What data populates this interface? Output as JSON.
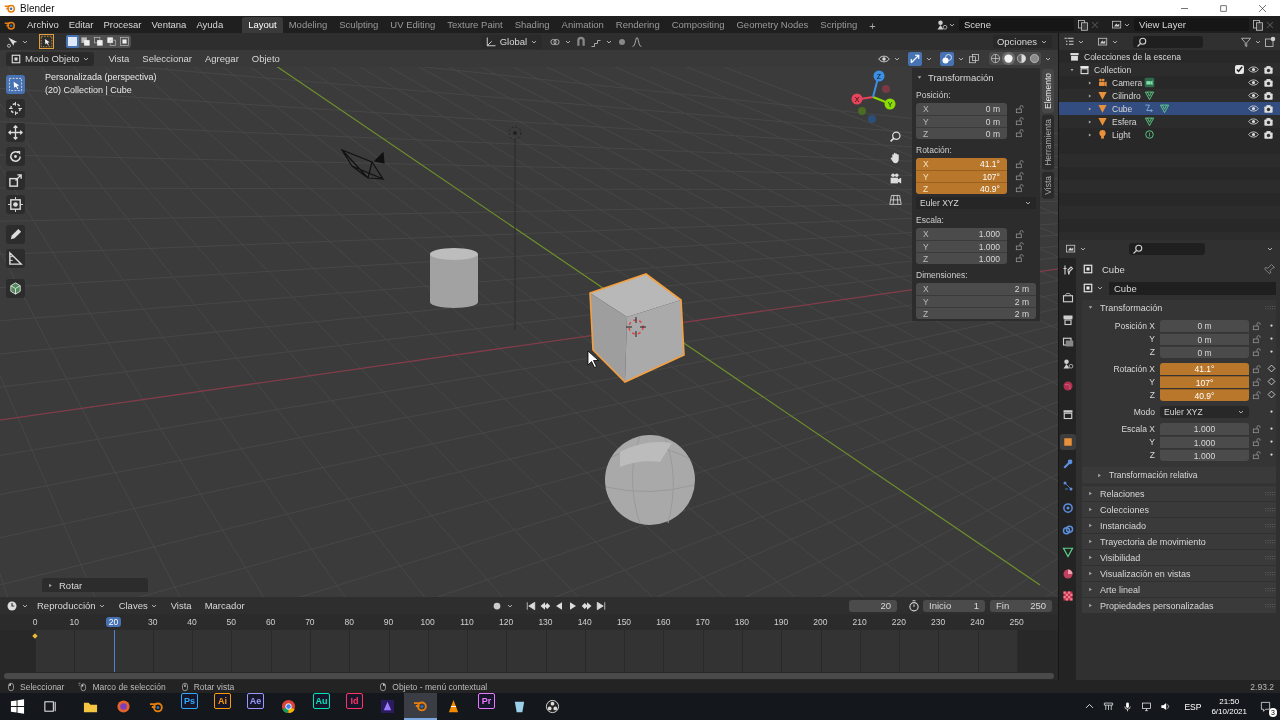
{
  "window": {
    "title": "Blender"
  },
  "top_bar": {
    "menus": [
      "Archivo",
      "Editar",
      "Procesar",
      "Ventana",
      "Ayuda"
    ],
    "workspaces": [
      {
        "label": "Layout",
        "selected": true
      },
      {
        "label": "Modeling",
        "selected": false
      },
      {
        "label": "Sculpting",
        "selected": false
      },
      {
        "label": "UV Editing",
        "selected": false
      },
      {
        "label": "Texture Paint",
        "selected": false
      },
      {
        "label": "Shading",
        "selected": false
      },
      {
        "label": "Animation",
        "selected": false
      },
      {
        "label": "Rendering",
        "selected": false
      },
      {
        "label": "Compositing",
        "selected": false
      },
      {
        "label": "Geometry Nodes",
        "selected": false
      },
      {
        "label": "Scripting",
        "selected": false
      }
    ],
    "add_workspace": "+",
    "scene": "Scene",
    "view_layer": "View Layer"
  },
  "tool_header": {
    "select_modes": [
      {
        "selected": true
      },
      {
        "selected": false
      },
      {
        "selected": false
      },
      {
        "selected": false
      },
      {
        "selected": false
      }
    ],
    "orientation": "Global",
    "options": "Opciones"
  },
  "viewport_header": {
    "mode": "Modo Objeto",
    "menus": [
      "Vista",
      "Seleccionar",
      "Agregar",
      "Objeto"
    ],
    "shading": [
      {
        "kind": "wireframe",
        "selected": false
      },
      {
        "kind": "solid",
        "selected": true
      },
      {
        "kind": "material",
        "selected": false
      },
      {
        "kind": "rendered",
        "selected": false
      }
    ]
  },
  "viewport": {
    "view_name": "Personalizada (perspectiva)",
    "context": "(20) Collection | Cube",
    "tools": [
      {
        "kind": "select",
        "selected": true
      },
      {
        "kind": "cursor",
        "selected": false
      },
      {
        "kind": "move",
        "selected": false
      },
      {
        "kind": "rotate",
        "selected": false
      },
      {
        "kind": "scale",
        "selected": false
      },
      {
        "kind": "transform",
        "selected": false
      },
      {
        "kind": "annotate",
        "selected": false
      },
      {
        "kind": "measure",
        "selected": false
      },
      {
        "kind": "add_cube",
        "selected": false
      }
    ],
    "gizmo": [
      {
        "label": "X",
        "color": "#e5445a"
      },
      {
        "label": "Y",
        "color": "#8bdc00"
      },
      {
        "label": "Z",
        "color": "#3a8fe6"
      }
    ],
    "last_operator": "Rotar"
  },
  "sidebar": {
    "tabs": [
      {
        "label": "Elemento",
        "selected": true
      },
      {
        "label": "Herramienta",
        "selected": false
      },
      {
        "label": "Vista",
        "selected": false
      }
    ],
    "title": "Transformación",
    "groups": [
      {
        "label": "Posición:",
        "locks": true,
        "fields": [
          {
            "axis": "X",
            "value": "0 m",
            "keyed": false
          },
          {
            "axis": "Y",
            "value": "0 m",
            "keyed": false
          },
          {
            "axis": "Z",
            "value": "0 m",
            "keyed": false
          }
        ]
      },
      {
        "label": "Rotación:",
        "locks": true,
        "fields": [
          {
            "axis": "X",
            "value": "41.1°",
            "keyed": true
          },
          {
            "axis": "Y",
            "value": "107°",
            "keyed": true
          },
          {
            "axis": "Z",
            "value": "40.9°",
            "keyed": true
          }
        ],
        "mode": "Euler XYZ"
      },
      {
        "label": "Escala:",
        "locks": true,
        "fields": [
          {
            "axis": "X",
            "value": "1.000",
            "keyed": false
          },
          {
            "axis": "Y",
            "value": "1.000",
            "keyed": false
          },
          {
            "axis": "Z",
            "value": "1.000",
            "keyed": false
          }
        ]
      },
      {
        "label": "Dimensiones:",
        "locks": false,
        "fields": [
          {
            "axis": "X",
            "value": "2 m",
            "keyed": false
          },
          {
            "axis": "Y",
            "value": "2 m",
            "keyed": false
          },
          {
            "axis": "Z",
            "value": "2 m",
            "keyed": false
          }
        ]
      }
    ]
  },
  "outliner": {
    "root": "Colecciones de la escena",
    "collection": {
      "name": "Collection",
      "checked": true,
      "expanded": true,
      "children": [
        {
          "name": "Camera",
          "kind": "camera",
          "selected": false,
          "expanded": false,
          "constraint": false
        },
        {
          "name": "Cilindro",
          "kind": "mesh",
          "selected": false,
          "expanded": false,
          "constraint": false
        },
        {
          "name": "Cube",
          "kind": "mesh",
          "selected": true,
          "expanded": false,
          "constraint": true
        },
        {
          "name": "Esfera",
          "kind": "mesh",
          "selected": false,
          "expanded": false,
          "constraint": false
        },
        {
          "name": "Light",
          "kind": "light",
          "selected": false,
          "expanded": false,
          "constraint": false
        }
      ]
    }
  },
  "properties": {
    "tabs": [
      {
        "kind": "tool",
        "selected": false
      },
      {
        "kind": "render",
        "selected": false
      },
      {
        "kind": "output",
        "selected": false
      },
      {
        "kind": "view_layer",
        "selected": false
      },
      {
        "kind": "scene",
        "selected": false
      },
      {
        "kind": "world",
        "selected": false
      },
      {
        "kind": "collection",
        "selected": false
      },
      {
        "kind": "object",
        "selected": true
      },
      {
        "kind": "modifier",
        "selected": false
      },
      {
        "kind": "particles",
        "selected": false
      },
      {
        "kind": "physics",
        "selected": false
      },
      {
        "kind": "constraints",
        "selected": false
      },
      {
        "kind": "data",
        "selected": false
      },
      {
        "kind": "material",
        "selected": false
      },
      {
        "kind": "texture",
        "selected": false
      }
    ],
    "object_name": "Cube",
    "data_name": "Cube",
    "section": {
      "title": "Transformación",
      "expanded": true
    },
    "groups": [
      {
        "rows": [
          {
            "label": "Posición X",
            "value": "0 m",
            "kind": "number",
            "keyed": false
          },
          {
            "label": "Y",
            "value": "0 m",
            "kind": "number",
            "keyed": false
          },
          {
            "label": "Z",
            "value": "0 m",
            "kind": "number",
            "keyed": false
          }
        ]
      },
      {
        "rows": [
          {
            "label": "Rotación X",
            "value": "41.1°",
            "kind": "number",
            "keyed": true
          },
          {
            "label": "Y",
            "value": "107°",
            "kind": "number",
            "keyed": true
          },
          {
            "label": "Z",
            "value": "40.9°",
            "kind": "number",
            "keyed": true
          }
        ]
      },
      {
        "rows": [
          {
            "label": "Modo",
            "value": "Euler XYZ",
            "kind": "dropdown",
            "keyed": false
          }
        ]
      },
      {
        "rows": [
          {
            "label": "Escala X",
            "value": "1.000",
            "kind": "number",
            "keyed": false
          },
          {
            "label": "Y",
            "value": "1.000",
            "kind": "number",
            "keyed": false
          },
          {
            "label": "Z",
            "value": "1.000",
            "kind": "number",
            "keyed": false
          }
        ]
      }
    ],
    "subsection": {
      "title": "Transformación relativa",
      "expanded": false
    },
    "sections": [
      {
        "title": "Relaciones",
        "expanded": false
      },
      {
        "title": "Colecciones",
        "expanded": false
      },
      {
        "title": "Instanciado",
        "expanded": false
      },
      {
        "title": "Trayectoria de movimiento",
        "expanded": false
      },
      {
        "title": "Visibilidad",
        "expanded": false
      },
      {
        "title": "Visualización en vistas",
        "expanded": false
      },
      {
        "title": "Arte lineal",
        "expanded": false
      },
      {
        "title": "Propiedades personalizadas",
        "expanded": false
      }
    ]
  },
  "timeline": {
    "menus": [
      {
        "label": "Reproducción",
        "dropdown": true
      },
      {
        "label": "Claves",
        "dropdown": true
      },
      {
        "label": "Vista",
        "dropdown": false
      },
      {
        "label": "Marcador",
        "dropdown": false
      }
    ],
    "current_frame": "20",
    "start_label": "Inicio",
    "start": "1",
    "end_label": "Fin",
    "end": "250",
    "ticks": [
      {
        "label": "0",
        "selected": false
      },
      {
        "label": "10",
        "selected": false
      },
      {
        "label": "20",
        "selected": true
      },
      {
        "label": "30",
        "selected": false
      },
      {
        "label": "40",
        "selected": false
      },
      {
        "label": "50",
        "selected": false
      },
      {
        "label": "60",
        "selected": false
      },
      {
        "label": "70",
        "selected": false
      },
      {
        "label": "80",
        "selected": false
      },
      {
        "label": "90",
        "selected": false
      },
      {
        "label": "100",
        "selected": false
      },
      {
        "label": "110",
        "selected": false
      },
      {
        "label": "120",
        "selected": false
      },
      {
        "label": "130",
        "selected": false
      },
      {
        "label": "140",
        "selected": false
      },
      {
        "label": "150",
        "selected": false
      },
      {
        "label": "160",
        "selected": false
      },
      {
        "label": "170",
        "selected": false
      },
      {
        "label": "180",
        "selected": false
      },
      {
        "label": "190",
        "selected": false
      },
      {
        "label": "200",
        "selected": false
      },
      {
        "label": "210",
        "selected": false
      },
      {
        "label": "220",
        "selected": false
      },
      {
        "label": "230",
        "selected": false
      },
      {
        "label": "240",
        "selected": false
      },
      {
        "label": "250",
        "selected": false
      }
    ]
  },
  "status_bar": {
    "hints": [
      {
        "kind": "left",
        "text": "Seleccionar"
      },
      {
        "kind": "drag",
        "text": "Marco de selección"
      },
      {
        "kind": "middle",
        "text": "Rotar vista"
      },
      {
        "kind": "right",
        "text": "Objeto - menú contextual"
      }
    ],
    "version": "2.93.2"
  },
  "taskbar": {
    "apps": [
      {
        "kind": "explorer",
        "active": false
      },
      {
        "kind": "firefox",
        "active": false
      },
      {
        "kind": "blender",
        "active": false
      },
      {
        "kind": "letters",
        "label": "Ps",
        "color": "#31a8ff",
        "active": false
      },
      {
        "kind": "letters",
        "label": "Ai",
        "color": "#ff9a00",
        "active": false
      },
      {
        "kind": "letters",
        "label": "Ae",
        "color": "#9999ff",
        "active": false
      },
      {
        "kind": "chrome",
        "active": false
      },
      {
        "kind": "letters",
        "label": "Au",
        "color": "#00e4bb",
        "active": false
      },
      {
        "kind": "letters",
        "label": "Id",
        "color": "#ff3366",
        "active": false
      },
      {
        "kind": "purple",
        "active": false
      },
      {
        "kind": "blender",
        "active": true
      },
      {
        "kind": "cone",
        "active": false
      },
      {
        "kind": "letters",
        "label": "Pr",
        "color": "#ea77ff",
        "active": false
      },
      {
        "kind": "glass",
        "active": false
      },
      {
        "kind": "obs",
        "active": false
      }
    ],
    "language": "ESP",
    "time": "21:50",
    "date": "6/10/2021",
    "notifications": "3"
  }
}
